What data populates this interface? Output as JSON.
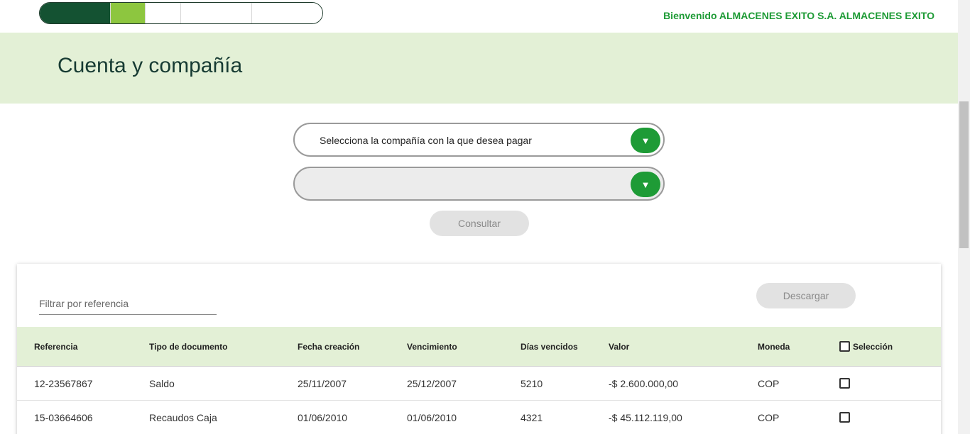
{
  "header": {
    "welcome": "Bienvenido ALMACENES EXITO S.A. ALMACENES EXITO",
    "progress_colors": [
      "#145232",
      "#8dc63f",
      "#ffffff",
      "#ffffff",
      "#ffffff"
    ]
  },
  "banner": {
    "title": "Cuenta y compañía"
  },
  "form": {
    "company_select": "Selecciona la compañía con la que desea pagar",
    "account_select": "",
    "consult_button": "Consultar"
  },
  "table_card": {
    "filter_placeholder": "Filtrar por referencia",
    "download_button": "Descargar",
    "columns": {
      "referencia": "Referencia",
      "tipo": "Tipo de documento",
      "fecha": "Fecha creación",
      "vencimiento": "Vencimiento",
      "dias": "Días vencidos",
      "valor": "Valor",
      "moneda": "Moneda",
      "seleccion": "Selección"
    },
    "rows": [
      {
        "referencia": "12-23567867",
        "tipo": "Saldo",
        "fecha": "25/11/2007",
        "vencimiento": "25/12/2007",
        "dias": "5210",
        "valor": "-$ 2.600.000,00",
        "moneda": "COP"
      },
      {
        "referencia": "15-03664606",
        "tipo": "Recaudos Caja",
        "fecha": "01/06/2010",
        "vencimiento": "01/06/2010",
        "dias": "4321",
        "valor": "-$ 45.112.119,00",
        "moneda": "COP"
      }
    ]
  },
  "icons": {
    "dropdown": "chevron-down-icon",
    "checkbox": "checkbox-icon"
  },
  "colors": {
    "brand_green": "#1e9b36",
    "banner_bg": "#e3f0d6",
    "title": "#173b33"
  }
}
